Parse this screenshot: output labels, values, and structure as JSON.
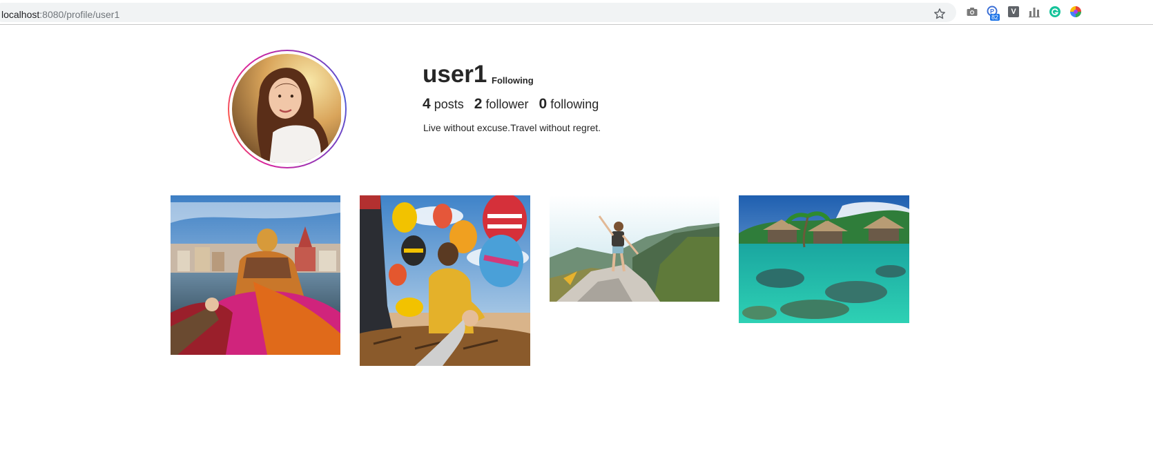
{
  "browser": {
    "url_host": "localhost",
    "url_path": ":8080/profile/user1",
    "extensions": [
      {
        "name": "camera-icon"
      },
      {
        "name": "extension-badge-icon",
        "badge": "82"
      },
      {
        "name": "v-extension-icon",
        "label": "V"
      },
      {
        "name": "chart-extension-icon"
      },
      {
        "name": "grammarly-icon"
      },
      {
        "name": "color-picker-icon"
      }
    ],
    "bookmark_icon": "star-icon"
  },
  "profile": {
    "username": "user1",
    "follow_status": "Following",
    "stats": {
      "posts_count": "4",
      "posts_label": "posts",
      "followers_count": "2",
      "followers_label": "follower",
      "following_count": "0",
      "following_label": "following"
    },
    "bio": "Live without excuse.Travel without regret.",
    "avatar_ring_colors": [
      "#d6249f",
      "#fd5949",
      "#8a3ab9",
      "#4f5bd5"
    ]
  },
  "posts": [
    {
      "id": 1,
      "subject": "holding hands on boat in front of temple city"
    },
    {
      "id": 2,
      "subject": "holding hands in hot air balloon basket"
    },
    {
      "id": 3,
      "subject": "hiker on mountain peak"
    },
    {
      "id": 4,
      "subject": "overwater bungalows over coral lagoon"
    }
  ]
}
